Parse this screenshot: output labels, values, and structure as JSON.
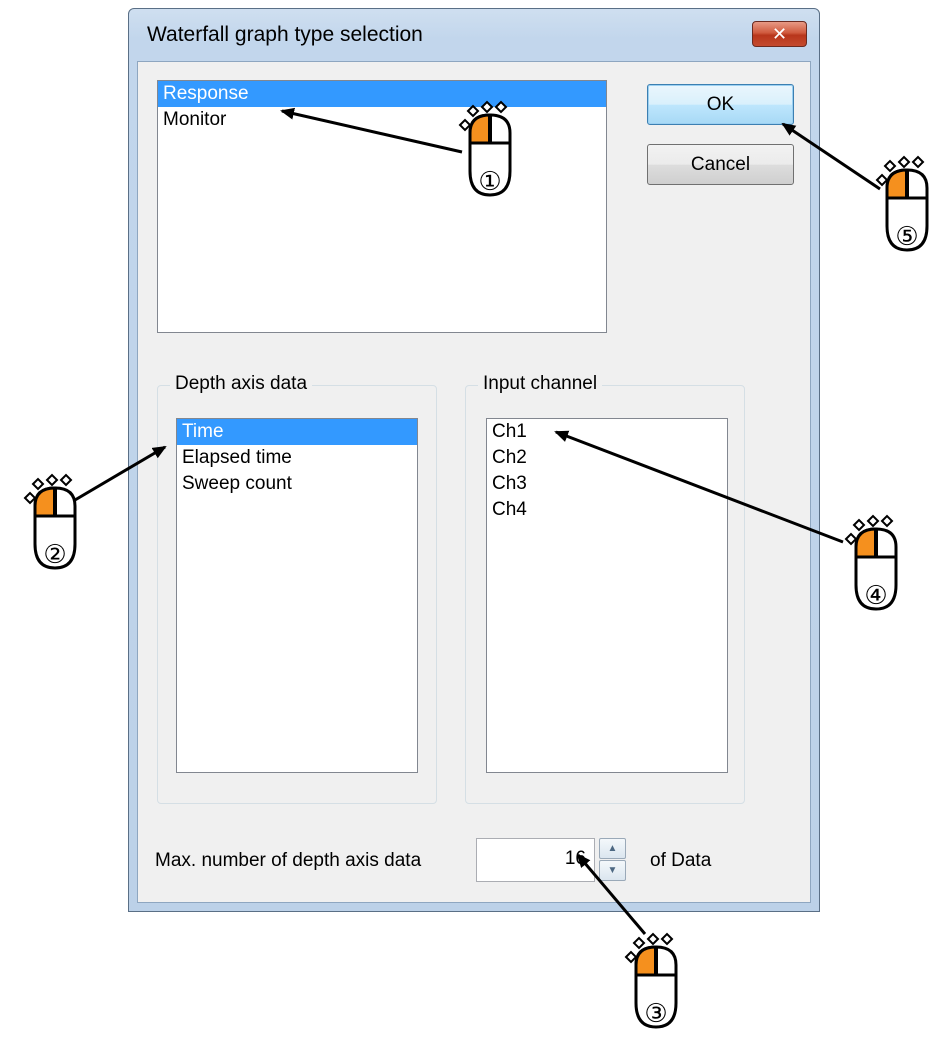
{
  "dialog": {
    "title": "Waterfall graph type selection",
    "close_label": "✕"
  },
  "graph_type_list": {
    "items": [
      "Response",
      "Monitor"
    ],
    "selected": "Response"
  },
  "buttons": {
    "ok": "OK",
    "cancel": "Cancel"
  },
  "depth_axis": {
    "label": "Depth axis data",
    "items": [
      "Time",
      "Elapsed time",
      "Sweep count"
    ],
    "selected": "Time"
  },
  "input_channel": {
    "label": "Input channel",
    "items": [
      "Ch1",
      "Ch2",
      "Ch3",
      "Ch4"
    ]
  },
  "max_depth": {
    "label": "Max. number of depth axis data",
    "value": "16",
    "suffix": "of Data"
  },
  "annotations": {
    "step1": "①",
    "step2": "②",
    "step3": "③",
    "step4": "④",
    "step5": "⑤"
  },
  "colors": {
    "selection": "#3399ff",
    "mouse_button": "#f5901e"
  }
}
